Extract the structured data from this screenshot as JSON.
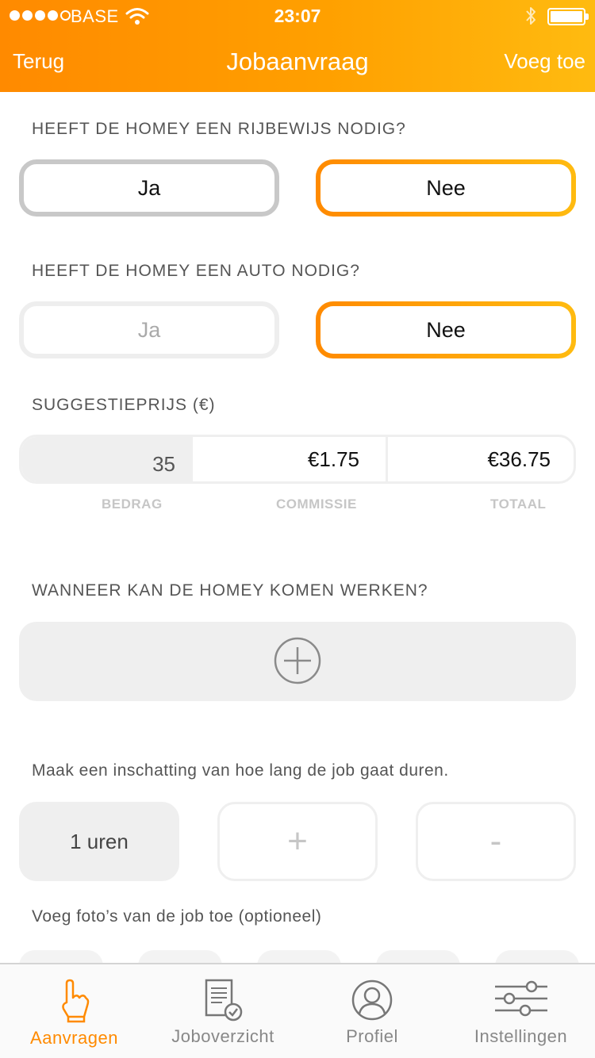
{
  "status_bar": {
    "carrier": "BASE",
    "time": "23:07",
    "signal_bars_filled": 4,
    "signal_bars_total": 5
  },
  "nav": {
    "back_label": "Terug",
    "title": "Jobaanvraag",
    "add_label": "Voeg toe"
  },
  "license_question": {
    "label": "HEEFT DE HOMEY EEN RIJBEWIJS NODIG?",
    "yes_label": "Ja",
    "no_label": "Nee",
    "selected": "Nee"
  },
  "car_question": {
    "label": "HEEFT DE HOMEY EEN AUTO NODIG?",
    "yes_label": "Ja",
    "no_label": "Nee",
    "selected": "Nee"
  },
  "price": {
    "label": "SUGGESTIEPRIJS (€)",
    "amount_value": "35",
    "commission_value": "€1.75",
    "total_value": "€36.75",
    "amount_caption": "BEDRAG",
    "commission_caption": "COMMISSIE",
    "total_caption": "TOTAAL"
  },
  "schedule": {
    "label": "WANNEER KAN DE HOMEY KOMEN WERKEN?",
    "add_icon": "plus-circle-icon"
  },
  "duration": {
    "hint": "Maak een inschatting van hoe lang de job gaat duren.",
    "value": "1 uren",
    "plus_label": "+",
    "minus_label": "-"
  },
  "photos": {
    "hint": "Voeg foto’s van de job toe (optioneel)"
  },
  "tabbar": {
    "tabs": [
      {
        "label": "Aanvragen",
        "icon": "hand-pointer-icon",
        "active": true
      },
      {
        "label": "Joboverzicht",
        "icon": "document-check-icon",
        "active": false
      },
      {
        "label": "Profiel",
        "icon": "user-circle-icon",
        "active": false
      },
      {
        "label": "Instellingen",
        "icon": "sliders-icon",
        "active": false
      }
    ]
  },
  "colors": {
    "accent_start": "#ff8a00",
    "accent_end": "#ffbb10",
    "inactive_border": "#c8c8c8",
    "field_bg": "#efefef",
    "tab_active": "#ff8a00",
    "tab_inactive": "#888888"
  }
}
